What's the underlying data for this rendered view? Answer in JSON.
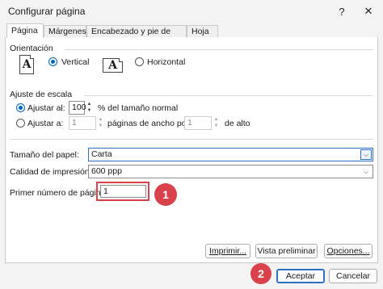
{
  "window": {
    "title": "Configurar página",
    "help_glyph": "?",
    "close_glyph": "✕"
  },
  "tabs": [
    {
      "label": "Página"
    },
    {
      "label": "Márgenes"
    },
    {
      "label": "Encabezado y pie de página"
    },
    {
      "label": "Hoja"
    }
  ],
  "orientation": {
    "heading": "Orientación",
    "portrait_icon_letter": "A",
    "landscape_icon_letter": "A",
    "vertical_label": "Vertical",
    "horizontal_label": "Horizontal",
    "selected": "vertical"
  },
  "scaling": {
    "heading": "Ajuste de escala",
    "adjust_to_label": "Ajustar al:",
    "adjust_to_value": "100",
    "adjust_to_suffix": "% del tamaño normal",
    "fit_to_label": "Ajustar a:",
    "fit_wide_value": "1",
    "fit_wide_suffix": "páginas de ancho por",
    "fit_tall_value": "1",
    "fit_tall_suffix": "de alto",
    "selected": "adjust_to"
  },
  "paper": {
    "paper_size_label": "Tamaño del papel:",
    "paper_size_value": "Carta",
    "print_quality_label": "Calidad de impresión:",
    "print_quality_value": "600 ppp",
    "first_page_label": "Primer número de página:",
    "first_page_value": "1"
  },
  "annotations": {
    "badge_1": "1",
    "badge_2": "2",
    "highlight_color": "#d9424a"
  },
  "buttons": {
    "print": "Imprimir...",
    "preview": "Vista preliminar",
    "options": "Opciones...",
    "ok": "Aceptar",
    "cancel": "Cancelar"
  },
  "colors": {
    "accent": "#0067c0",
    "focus_border": "#2f6fc2"
  }
}
